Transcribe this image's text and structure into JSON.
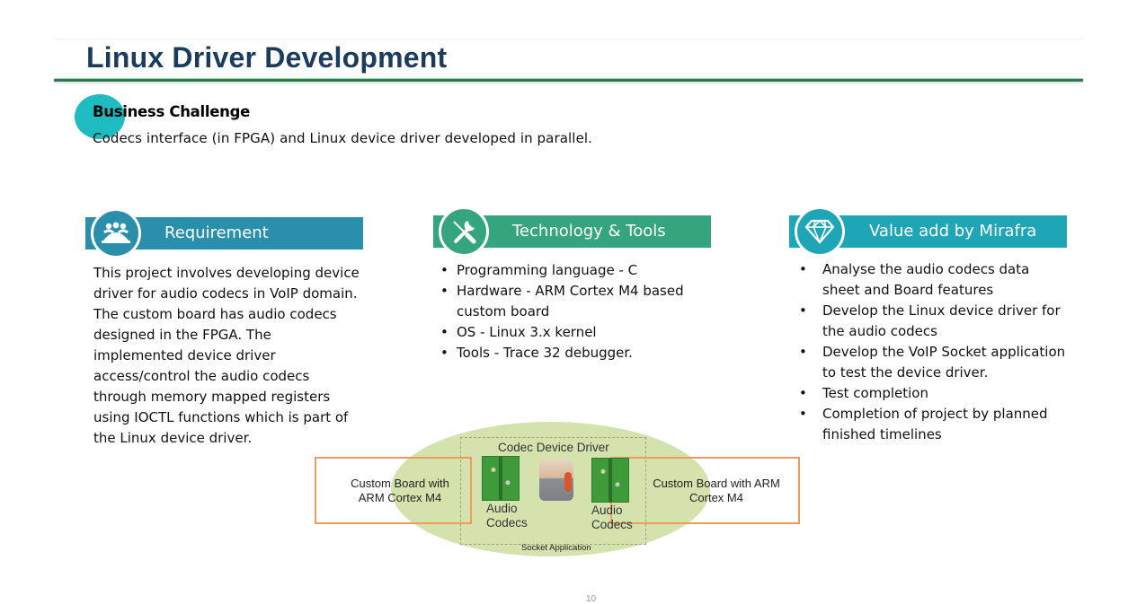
{
  "header": {
    "title": "Linux Driver Development"
  },
  "business_challenge": {
    "heading": "Business Challenge",
    "text": "Codecs interface (in FPGA) and Linux device driver developed in parallel."
  },
  "sections": {
    "requirement": {
      "icon": "people-group-icon",
      "title": "Requirement",
      "color": "#2a8fab",
      "text": "This project involves developing device driver for audio codecs in VoIP domain. The custom board has audio codecs designed in the FPGA. The implemented device driver access/control the audio codecs through memory mapped registers using IOCTL functions which is part of the Linux device driver."
    },
    "technology": {
      "icon": "wrench-screwdriver-icon",
      "title": "Technology & Tools",
      "color": "#34a57d",
      "items": [
        "Programming language - C",
        "Hardware - ARM Cortex M4 based custom board",
        "OS - Linux 3.x kernel",
        "Tools - Trace 32 debugger."
      ]
    },
    "value_add": {
      "icon": "diamond-icon",
      "title": "Value add by Mirafra",
      "color": "#1fa6b6",
      "items": [
        "Analyse the audio codecs data sheet and Board features",
        "Develop the Linux device driver for the audio codecs",
        "Develop the VoIP Socket application to test the device driver.",
        "Test completion",
        "Completion of project by planned finished timelines"
      ]
    }
  },
  "diagram": {
    "left_board": "Custom Board with ARM Cortex M4",
    "right_board": "Custom Board with ARM Cortex M4",
    "driver_label": "Codec Device Driver",
    "codec_left": "Audio Codecs",
    "codec_right": "Audio Codecs",
    "socket_label": "Socket Application"
  },
  "footer": {
    "page_number": "10"
  }
}
